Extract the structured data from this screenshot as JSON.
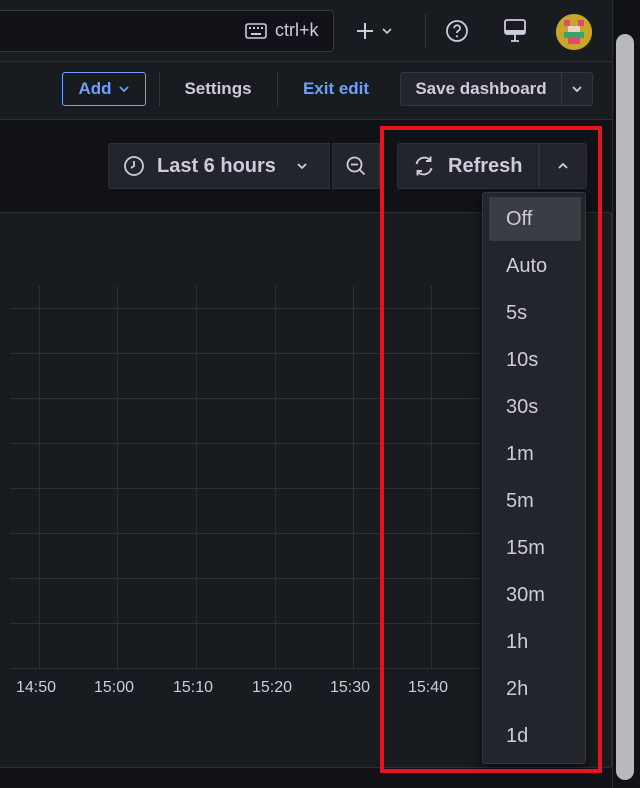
{
  "topbar": {
    "search_shortcut": "ctrl+k"
  },
  "toolbar": {
    "add_label": "Add",
    "settings_label": "Settings",
    "exit_edit_label": "Exit edit",
    "save_label": "Save dashboard"
  },
  "time_controls": {
    "time_range_label": "Last 6 hours",
    "refresh_label": "Refresh"
  },
  "refresh_menu": {
    "selected": "Off",
    "options": [
      "Off",
      "Auto",
      "5s",
      "10s",
      "30s",
      "1m",
      "5m",
      "15m",
      "30m",
      "1h",
      "2h",
      "1d"
    ]
  },
  "chart": {
    "x_ticks": [
      "14:50",
      "15:00",
      "15:10",
      "15:20",
      "15:30",
      "15:40"
    ]
  },
  "colors": {
    "accent_blue": "#6e9fff",
    "highlight_red": "#e6151b",
    "background": "#111217",
    "panel": "#181b1f"
  }
}
